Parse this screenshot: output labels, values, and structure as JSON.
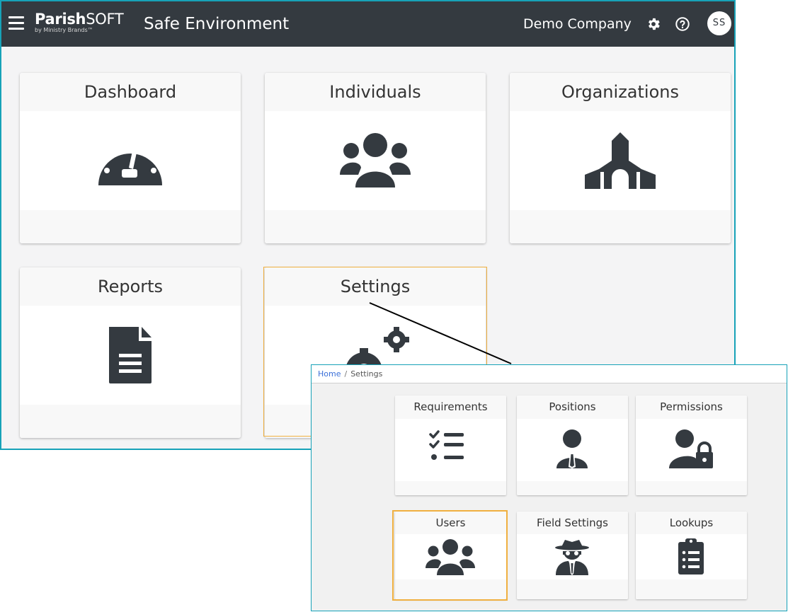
{
  "navbar": {
    "brand_prefix": "Parish",
    "brand_suffix": "SOFT",
    "brand_tagline": "by Ministry Brands™",
    "app_title": "Safe Environment",
    "company": "Demo Company",
    "avatar_initials": "SS",
    "icons": [
      "menu-icon",
      "gear-icon",
      "help-icon"
    ],
    "bg_color": "#343a40"
  },
  "dashboard": {
    "cards": [
      {
        "label": "Dashboard",
        "icon": "speedometer-icon"
      },
      {
        "label": "Individuals",
        "icon": "users-icon"
      },
      {
        "label": "Organizations",
        "icon": "church-icon"
      },
      {
        "label": "Reports",
        "icon": "document-icon"
      },
      {
        "label": "Settings",
        "icon": "cogs-icon"
      }
    ]
  },
  "settings_page": {
    "breadcrumb": {
      "home": "Home",
      "separator": "/",
      "current": "Settings"
    },
    "cards": [
      {
        "label": "Requirements",
        "icon": "checklist-icon"
      },
      {
        "label": "Positions",
        "icon": "user-tie-icon"
      },
      {
        "label": "Permissions",
        "icon": "user-lock-icon"
      },
      {
        "label": "Users",
        "icon": "users-icon"
      },
      {
        "label": "Field Settings",
        "icon": "user-secret-icon"
      },
      {
        "label": "Lookups",
        "icon": "clipboard-list-icon"
      }
    ]
  },
  "colors": {
    "accent_border": "#17a2b8",
    "highlight": "#f0b040",
    "icon": "#343a40",
    "link": "#3a6fd8"
  }
}
